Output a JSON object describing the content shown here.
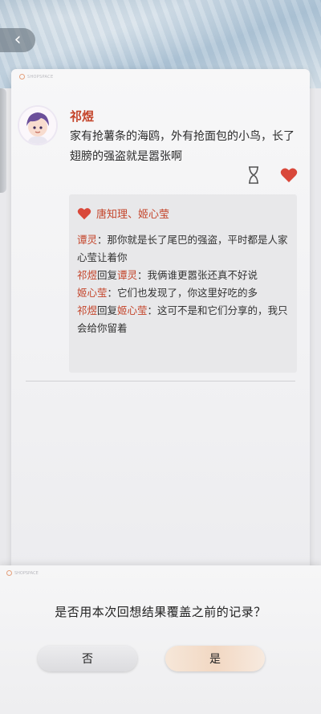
{
  "nav": {
    "back_glyph": "‹"
  },
  "post": {
    "watermark": "SHOPSPACE",
    "sender": "祁煜",
    "text": "家有抢薯条的海鸥，外有抢面包的小鸟，长了翅膀的强盗就是嚣张啊",
    "likes": "唐知理、姬心莹",
    "comments": [
      {
        "name": "谭灵",
        "reply_to": "",
        "text": "：那你就是长了尾巴的强盗，平时都是人家心莹让着你"
      },
      {
        "name": "祁煜",
        "reply_to": "谭灵",
        "text": "：我俩谁更嚣张还真不好说"
      },
      {
        "name": "姬心莹",
        "reply_to": "",
        "text": "：它们也发现了，你这里好吃的多"
      },
      {
        "name": "祁煜",
        "reply_to": "姬心莹",
        "text": "：这可不是和它们分享的，我只会给你留着"
      }
    ],
    "reply_word": "回复"
  },
  "dialog": {
    "watermark": "SHOPSPACE",
    "question": "是否用本次回想结果覆盖之前的记录？",
    "no_label": "否",
    "yes_label": "是"
  },
  "colors": {
    "name_red": "#c4442a",
    "accent_heart": "#d9483a"
  }
}
